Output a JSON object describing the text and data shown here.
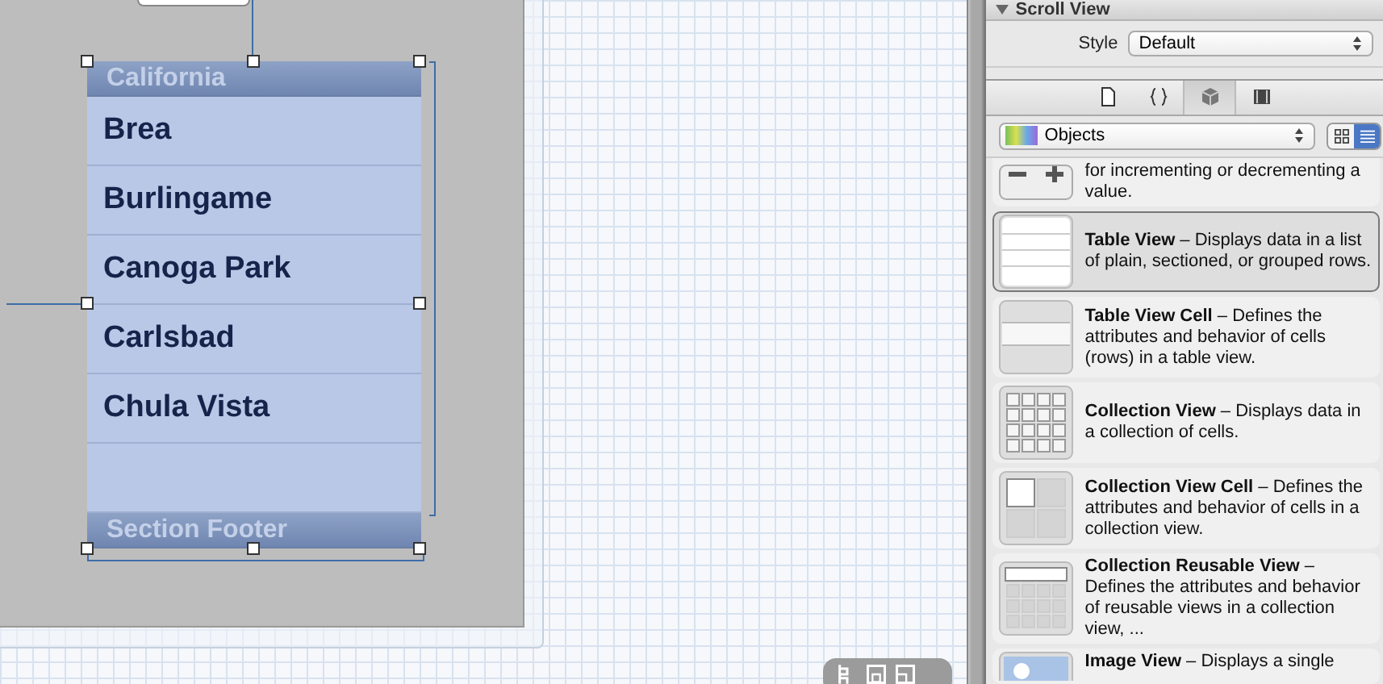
{
  "table_view": {
    "header": "California",
    "rows": [
      {
        "label": "Brea"
      },
      {
        "label": "Burlingame"
      },
      {
        "label": "Canoga Park"
      },
      {
        "label": "Carlsbad"
      },
      {
        "label": "Chula Vista"
      },
      {
        "label": ""
      }
    ],
    "footer": "Section Footer"
  },
  "inspector": {
    "section": "Scroll View",
    "expanded": true,
    "style_label": "Style",
    "style_value": "Default"
  },
  "library_tabs": [
    {
      "kind": "file",
      "selected": false
    },
    {
      "kind": "braces",
      "selected": false
    },
    {
      "kind": "cube",
      "selected": true
    },
    {
      "kind": "film",
      "selected": false
    }
  ],
  "library_filter": "Objects",
  "view_modes": [
    {
      "kind": "grid",
      "selected": false
    },
    {
      "kind": "list",
      "selected": true
    }
  ],
  "library_items": [
    {
      "kind": "stepper",
      "text": "for incrementing or decrementing a value.",
      "selected": false
    },
    {
      "kind": "table",
      "text": "**Table View** – Displays data in a list of plain, sectioned, or grouped rows.",
      "selected": true
    },
    {
      "kind": "cell",
      "text": "**Table View Cell** – Defines the attributes and behavior of cells (rows) in a table view.",
      "selected": false
    },
    {
      "kind": "collection",
      "text": "**Collection View** – Displays data in a collection of cells.",
      "selected": false
    },
    {
      "kind": "collection-cell",
      "text": "**Collection View Cell** – Defines the attributes and behavior of cells in a collection view.",
      "selected": false
    },
    {
      "kind": "reusable",
      "text": "**Collection Reusable View** – Defines the attributes and behavior of reusable views in a collection view, ...",
      "selected": false
    },
    {
      "kind": "image",
      "text": "**Image View** – Displays a single",
      "selected": false
    }
  ]
}
